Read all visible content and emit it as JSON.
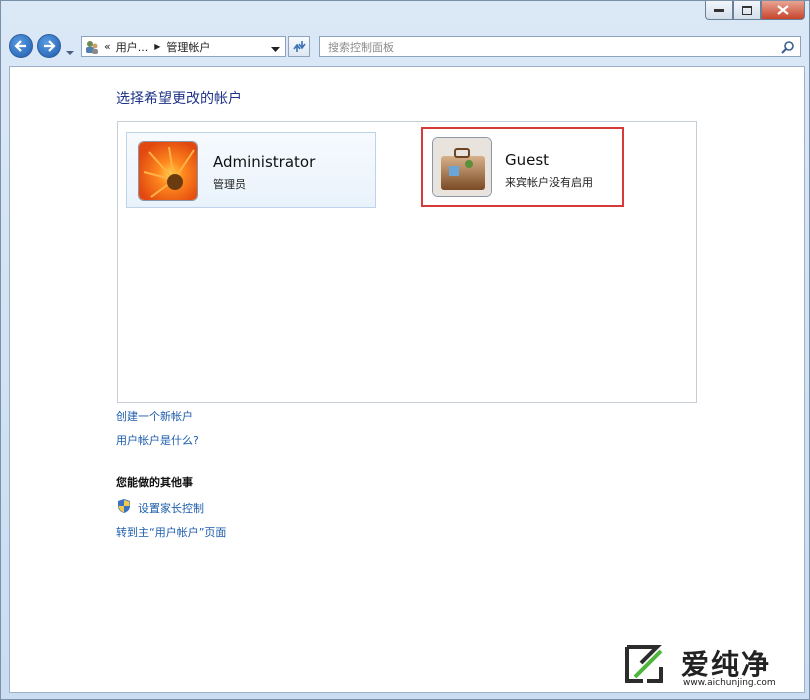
{
  "address": {
    "crumb_1": "用户...",
    "crumb_2": "管理帐户",
    "overflow": "«"
  },
  "search": {
    "placeholder": "搜索控制面板"
  },
  "main": {
    "heading": "选择希望更改的帐户",
    "accounts": [
      {
        "name": "Administrator",
        "type": "管理员",
        "icon": "flower-icon"
      },
      {
        "name": "Guest",
        "type": "来宾帐户没有启用",
        "icon": "briefcase-icon"
      }
    ],
    "links": {
      "create_account": "创建一个新帐户",
      "what_is": "用户帐户是什么?"
    },
    "other_title": "您能做的其他事",
    "other_links": {
      "parental": "设置家长控制",
      "go_main": "转到主“用户帐户”页面"
    }
  },
  "watermark": {
    "title": "爱纯净",
    "url": "www.aichunjing.com"
  },
  "colors": {
    "link": "#1c5dab",
    "heading": "#1e3287",
    "highlight": "#d83a3a"
  }
}
